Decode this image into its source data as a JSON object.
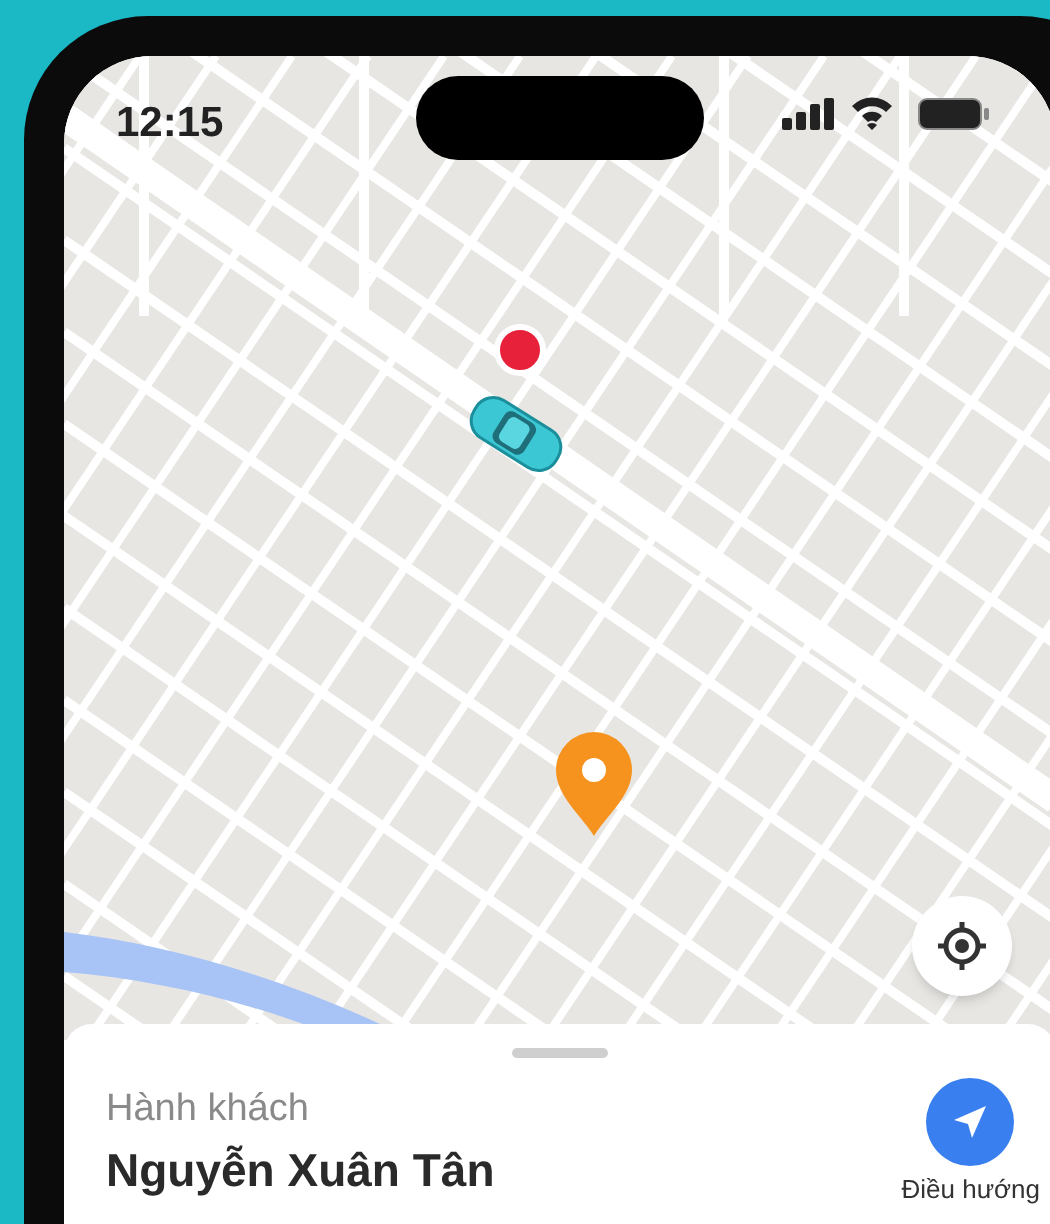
{
  "status_bar": {
    "time": "12:15"
  },
  "passenger": {
    "label": "Hành khách",
    "name": "Nguyễn Xuân Tân"
  },
  "navigate_button": {
    "label": "Điều hướng"
  }
}
